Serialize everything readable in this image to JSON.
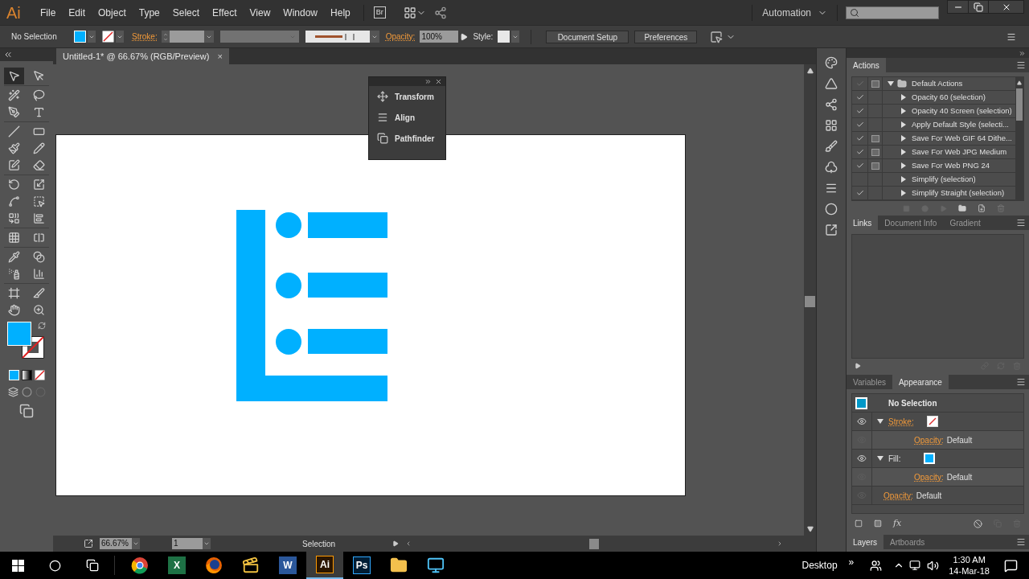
{
  "app_logo": "Ai",
  "menu": [
    "File",
    "Edit",
    "Object",
    "Type",
    "Select",
    "Effect",
    "View",
    "Window",
    "Help"
  ],
  "bridge_label": "Br",
  "workspace": "Automation",
  "control_bar": {
    "selection": "No Selection",
    "stroke_label": "Stroke:",
    "opacity_label": "Opacity:",
    "opacity_value": "100%",
    "style_label": "Style:",
    "buttons": [
      "Document Setup",
      "Preferences"
    ]
  },
  "document_tab": {
    "title": "Untitled-1* @ 66.67% (RGB/Preview)",
    "close": "×"
  },
  "tools": [
    {
      "selected": true
    },
    {
      "selected": false
    },
    {
      "selected": false
    },
    {
      "selected": false
    },
    {
      "selected": false
    },
    {
      "selected": false
    },
    {
      "selected": false
    },
    {
      "selected": false
    },
    {
      "selected": false
    },
    {
      "selected": false
    },
    {
      "selected": false
    },
    {
      "selected": false
    },
    {
      "selected": false
    },
    {
      "selected": false
    },
    {
      "selected": false
    },
    {
      "selected": false
    },
    {
      "selected": false
    },
    {
      "selected": false
    },
    {
      "selected": false
    },
    {
      "selected": false
    },
    {
      "selected": false
    },
    {
      "selected": false
    },
    {
      "selected": false
    },
    {
      "selected": false
    },
    {
      "selected": false
    },
    {
      "selected": false
    },
    {
      "selected": false
    },
    {
      "selected": false
    }
  ],
  "floating_panel": {
    "items": [
      "Transform",
      "Align",
      "Pathfinder"
    ]
  },
  "actions_panel": {
    "tabs": [
      {
        "label": "Actions",
        "selected": true
      }
    ],
    "rows": [
      {
        "kind": "set",
        "name": "Default Actions",
        "checked": true,
        "dialog": true,
        "expanded": true
      },
      {
        "kind": "action",
        "name": "Opacity 60 (selection)",
        "checked": true,
        "dialog": false,
        "expanded": false
      },
      {
        "kind": "action",
        "name": "Opacity 40 Screen (selection)",
        "checked": true,
        "dialog": false,
        "expanded": false
      },
      {
        "kind": "action",
        "name": "Apply Default Style (selecti...",
        "checked": true,
        "dialog": false,
        "expanded": false
      },
      {
        "kind": "action",
        "name": "Save For Web GIF 64 Dithe...",
        "checked": true,
        "dialog": true,
        "expanded": false
      },
      {
        "kind": "action",
        "name": "Save For Web JPG Medium",
        "checked": true,
        "dialog": true,
        "expanded": false
      },
      {
        "kind": "action",
        "name": "Save For Web PNG 24",
        "checked": true,
        "dialog": true,
        "expanded": false
      },
      {
        "kind": "action",
        "name": "Simplify (selection)",
        "checked": false,
        "dialog": false,
        "expanded": false
      },
      {
        "kind": "action",
        "name": "Simplify Straight (selection)",
        "checked": true,
        "dialog": false,
        "expanded": false
      }
    ]
  },
  "links_panel": {
    "tabs": [
      {
        "label": "Links",
        "selected": true
      },
      {
        "label": "Document Info",
        "selected": false
      },
      {
        "label": "Gradient",
        "selected": false
      }
    ]
  },
  "appearance_panel": {
    "tabs": [
      {
        "label": "Variables",
        "selected": false
      },
      {
        "label": "Appearance",
        "selected": true
      }
    ],
    "title": "No Selection",
    "rows": [
      {
        "kind": "stroke",
        "label": "Stroke:",
        "expanded": true,
        "children": [
          {
            "kind": "opacity",
            "label": "Opacity:",
            "value": "Default"
          }
        ]
      },
      {
        "kind": "fill",
        "label": "Fill:",
        "expanded": true,
        "children": [
          {
            "kind": "opacity",
            "label": "Opacity:",
            "value": "Default"
          }
        ]
      },
      {
        "kind": "opacity",
        "label": "Opacity:",
        "value": "Default"
      }
    ],
    "fx_label": "fx"
  },
  "layers_panel": {
    "tabs": [
      {
        "label": "Layers",
        "selected": true
      },
      {
        "label": "Artboards",
        "selected": false
      }
    ]
  },
  "status_bar": {
    "zoom": "66.67%",
    "artboard": "1",
    "status": "Selection"
  },
  "taskbar": {
    "apps": [
      {
        "kind": "chrome",
        "selected": false
      },
      {
        "kind": "excel",
        "label": "X",
        "selected": false
      },
      {
        "kind": "firefox",
        "selected": false
      },
      {
        "kind": "movie",
        "selected": false
      },
      {
        "kind": "word",
        "label": "W",
        "selected": false
      },
      {
        "kind": "illustrator",
        "label": "Ai",
        "selected": true
      },
      {
        "kind": "photoshop",
        "label": "Ps",
        "selected": false
      },
      {
        "kind": "folder",
        "selected": false
      },
      {
        "kind": "network",
        "selected": false
      }
    ],
    "desktop": "Desktop",
    "more": "»",
    "time": "1:30 AM",
    "date": "14-Mar-18"
  }
}
